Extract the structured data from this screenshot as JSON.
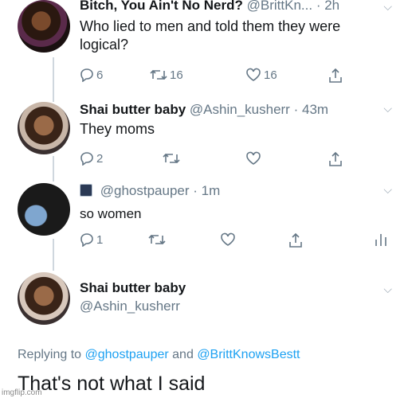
{
  "tweets": [
    {
      "name": "Bitch, You Ain't No Nerd?",
      "handle": "@BrittKn...",
      "dot": "·",
      "time": "2h",
      "text": "Who lied to men and told them they were logical?",
      "reply_count": "6",
      "retweet_count": "16",
      "like_count": "16"
    },
    {
      "name": "Shai butter baby",
      "handle": "@Ashin_kusherr",
      "dot": "·",
      "time": "43m",
      "text": "They moms",
      "reply_count": "2"
    },
    {
      "name": "",
      "handle": "@ghostpauper",
      "dot": "·",
      "time": "1m",
      "text": "so women",
      "reply_count": "1"
    },
    {
      "name": "Shai butter baby",
      "handle": "@Ashin_kusherr"
    }
  ],
  "replying": {
    "prefix": "Replying to",
    "user1": "@ghostpauper",
    "and": "and",
    "user2": "@BrittKnowsBestt"
  },
  "final_text": "That's not what I said",
  "watermark": "imgflip.com",
  "colors": {
    "accent": "#1da1f2",
    "muted": "#657786",
    "text": "#14171a"
  }
}
